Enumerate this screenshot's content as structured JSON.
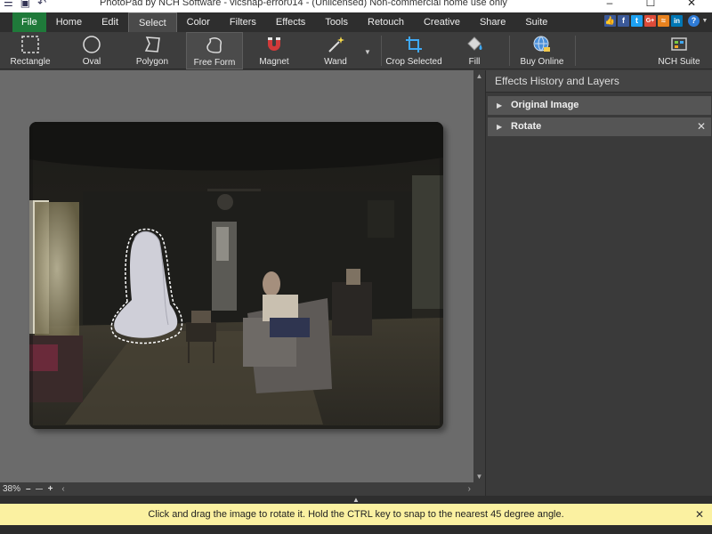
{
  "window": {
    "title": "PhotoPad by NCH Software - vicsnap-error014 - (Unlicensed) Non-commercial home use only",
    "controls": [
      "–",
      "☐",
      "✕"
    ]
  },
  "menu": {
    "tabs": [
      "File",
      "Home",
      "Edit",
      "Select",
      "Color",
      "Filters",
      "Effects",
      "Tools",
      "Retouch",
      "Creative",
      "Share",
      "Suite"
    ],
    "active": "Select"
  },
  "social": {
    "icons": [
      "like-icon",
      "facebook-icon",
      "twitter-icon",
      "google-plus-icon",
      "nch-icon",
      "linkedin-icon",
      "help-icon"
    ],
    "labels": [
      "👍",
      "f",
      "t",
      "G+",
      "≈",
      "in",
      "?"
    ]
  },
  "toolbar": {
    "rectangle": "Rectangle",
    "oval": "Oval",
    "polygon": "Polygon",
    "free_form": "Free Form",
    "magnet": "Magnet",
    "wand": "Wand",
    "crop_selected": "Crop Selected",
    "fill": "Fill",
    "buy_online": "Buy Online",
    "nch_suite": "NCH Suite"
  },
  "status": {
    "zoom": "38%",
    "zoom_out": "–",
    "zoom_in": "+"
  },
  "panel": {
    "title": "Effects History and Layers",
    "items": [
      "Original Image",
      "Rotate"
    ]
  },
  "hint": {
    "text": "Click and drag the image to rotate it. Hold the CTRL key to snap to the nearest 45 degree angle."
  },
  "colors": {
    "file_tab": "#1f7a3a",
    "hint_bg": "#fbf1a1",
    "canvas_bg": "#6b6b6b"
  }
}
